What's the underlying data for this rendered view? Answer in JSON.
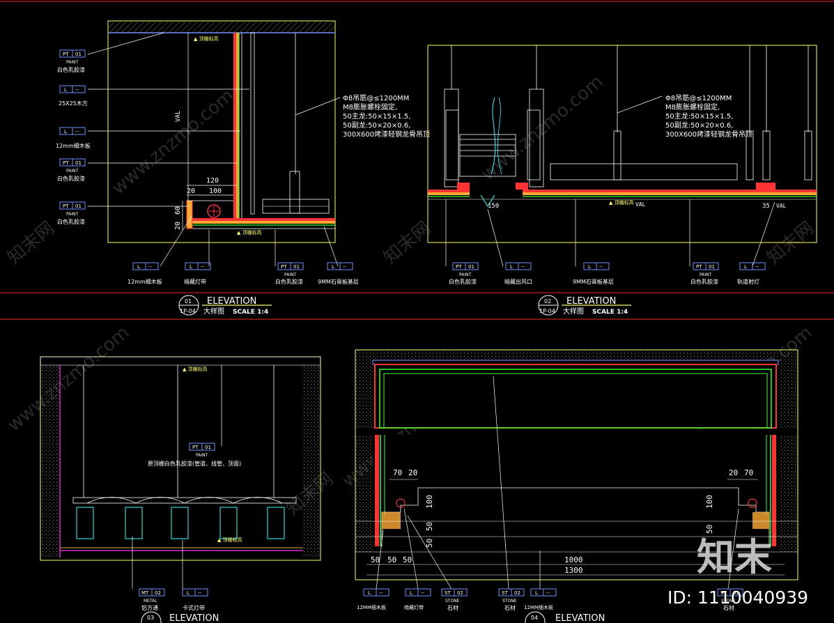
{
  "colors": {
    "background": "#000000",
    "frame": "#ffff66",
    "leader": "#ffffff",
    "tag": "#6f8fff",
    "dim": "#ffffff",
    "red": "#ff3333",
    "green": "#33ff33",
    "cyan": "#33ffff",
    "magenta": "#ff33ff",
    "divider": "#ff2222",
    "watermark": "#2a2a2a",
    "id_text": "#ffffff"
  },
  "tags": {
    "pt01": {
      "code": "PT",
      "num": "01",
      "sub": "PAINT"
    },
    "l": {
      "code": "L",
      "num": "--"
    },
    "mt02": {
      "code": "MT",
      "num": "02",
      "sub": "METAL"
    },
    "st02": {
      "code": "ST",
      "num": "02",
      "sub": "STONE"
    }
  },
  "d1": {
    "labels": {
      "paint1": "白色乳胶漆",
      "wood": "25X25木方",
      "board": "12mm细木板",
      "paint2": "白色乳胶漆",
      "paint3": "白色乳胶漆"
    },
    "bottom_labels": {
      "board": "12mm细木板",
      "light": "暗藏灯带",
      "paint": "白色乳胶漆",
      "gypsum": "9MM石膏板基层"
    },
    "note": [
      "Φ8吊筋@≤1200MM",
      "M8膨胀螺栓固定,",
      "50主龙:50×15×1.5,",
      "50副龙:50×20×0.6,",
      "300X600烤漆轻钢龙骨吊顶"
    ],
    "dims": {
      "top1": "120",
      "a": "20",
      "b": "100",
      "v1": "60",
      "v2": "20",
      "val": "VAL"
    },
    "level_top": "▲ 顶棚标高",
    "level_bottom": "▲ 顶棚标高",
    "title": {
      "num": "01",
      "sheet": "1P-04",
      "heading": "ELEVATION",
      "cn": "大样图",
      "scale": "SCALE 1:4"
    }
  },
  "d2": {
    "note": [
      "Φ8吊筋@≤1200MM",
      "M8膨胀螺栓固定,",
      "50主龙:50×15×1.5,",
      "50副龙:50×20×0.6,",
      "300X600烤漆轻钢龙骨吊顶"
    ],
    "dims": {
      "d150": "150",
      "d35": "35",
      "val": "VAL"
    },
    "level": "▲ 顶棚标高",
    "bottom_labels": {
      "paint1": "白色乳胶漆",
      "vent": "暗藏出风口",
      "gypsum": "9MM石膏板基层",
      "paint2": "白色乳胶漆",
      "track": "轨道射灯"
    },
    "title": {
      "num": "02",
      "sheet": "1P-04",
      "heading": "ELEVATION",
      "cn": "大样图",
      "scale": "SCALE 1:4"
    }
  },
  "d3": {
    "level_top": "▲ 顶棚标高",
    "note": "原顶棚白色乳胶漆(管道、线管、顶面)",
    "level_bottom": "▲ 顶棚标高",
    "bottom_labels": {
      "metal": "铝方通",
      "light": "卡式灯带"
    },
    "title": {
      "num": "03",
      "heading": "ELEVATION"
    }
  },
  "d4": {
    "dims": {
      "l70": "70",
      "l20": "20",
      "r20": "20",
      "r70": "70",
      "l100": "100",
      "l50a": "50",
      "l50b": "50",
      "r100": "100",
      "r50": "50",
      "b50a": "50",
      "b50b": "50",
      "b50c": "50",
      "w1000": "1000",
      "w1300": "1300"
    },
    "bottom_labels": {
      "board": "12MM细木板",
      "light": "暗藏灯带",
      "stone1": "石材",
      "stone2": "石材",
      "board2": "12MM细木板",
      "stone3": "石材"
    },
    "title": {
      "num": "04",
      "heading": "ELEVATION"
    }
  },
  "watermark": {
    "text": "www.znzmo.com",
    "cn": "知末网",
    "logo": "知末",
    "id": "ID: 1110040939"
  }
}
